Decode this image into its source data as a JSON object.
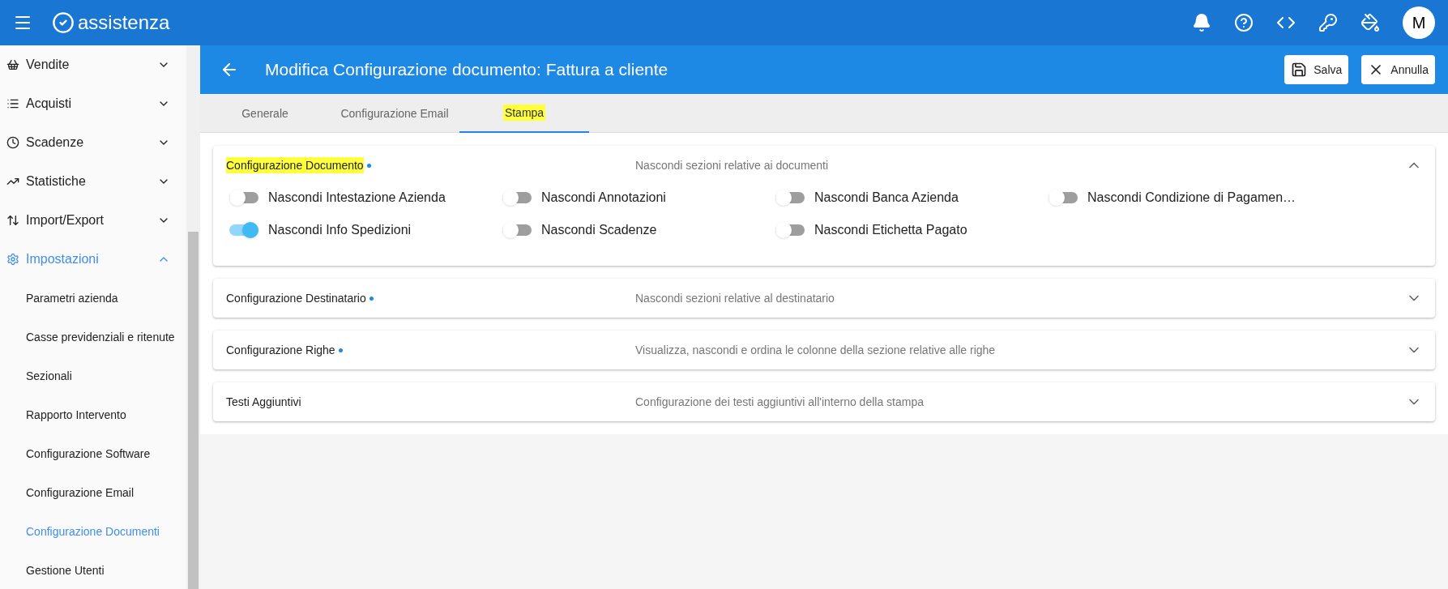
{
  "app_bar": {
    "logo": "assistenza",
    "avatar": "M"
  },
  "sidebar": {
    "items": [
      {
        "label": "Vendite",
        "expanded": false,
        "selected": false
      },
      {
        "label": "Acquisti",
        "expanded": false,
        "selected": false
      },
      {
        "label": "Scadenze",
        "expanded": false,
        "selected": false
      },
      {
        "label": "Statistiche",
        "expanded": false,
        "selected": false
      },
      {
        "label": "Import/Export",
        "expanded": false,
        "selected": false
      },
      {
        "label": "Impostazioni",
        "expanded": true,
        "selected": true,
        "children": [
          {
            "label": "Parametri azienda",
            "selected": false
          },
          {
            "label": "Casse previdenziali e ritenute",
            "selected": false
          },
          {
            "label": "Sezionali",
            "selected": false
          },
          {
            "label": "Rapporto Intervento",
            "selected": false
          },
          {
            "label": "Configurazione Software",
            "selected": false
          },
          {
            "label": "Configurazione Email",
            "selected": false
          },
          {
            "label": "Configurazione Documenti",
            "selected": true
          },
          {
            "label": "Gestione Utenti",
            "selected": false
          }
        ]
      }
    ]
  },
  "header": {
    "title": "Modifica Configurazione documento: Fattura a cliente",
    "buttons": [
      {
        "label": "Salva",
        "kind": "save"
      },
      {
        "label": "Annulla",
        "kind": "cancel"
      }
    ]
  },
  "tabs": [
    {
      "label": "Generale",
      "selected": false,
      "highlighted": false
    },
    {
      "label": "Configurazione Email",
      "selected": false,
      "highlighted": false
    },
    {
      "label": "Stampa",
      "selected": true,
      "highlighted": true
    }
  ],
  "sections": [
    {
      "title": "Configurazione Documento",
      "dot": true,
      "highlighted": true,
      "description": "Nascondi sezioni relative ai documenti",
      "expanded": true,
      "toggles": [
        {
          "label": "Nascondi Intestazione Azienda",
          "on": false
        },
        {
          "label": "Nascondi Annotazioni",
          "on": false
        },
        {
          "label": "Nascondi Banca Azienda",
          "on": false
        },
        {
          "label": "Nascondi Condizione di Pagamen…",
          "on": false
        },
        {
          "label": "Nascondi Info Spedizioni",
          "on": true
        },
        {
          "label": "Nascondi Scadenze",
          "on": false
        },
        {
          "label": "Nascondi Etichetta Pagato",
          "on": false
        }
      ]
    },
    {
      "title": "Configurazione Destinatario",
      "dot": true,
      "highlighted": false,
      "description": "Nascondi sezioni relative al destinatario",
      "expanded": false
    },
    {
      "title": "Configurazione Righe",
      "dot": true,
      "highlighted": false,
      "description": "Visualizza, nascondi e ordina le colonne della sezione relative alle righe",
      "expanded": false
    },
    {
      "title": "Testi Aggiuntivi",
      "dot": false,
      "highlighted": false,
      "description": "Configurazione dei testi aggiuntivi all'interno della stampa",
      "expanded": false
    }
  ]
}
